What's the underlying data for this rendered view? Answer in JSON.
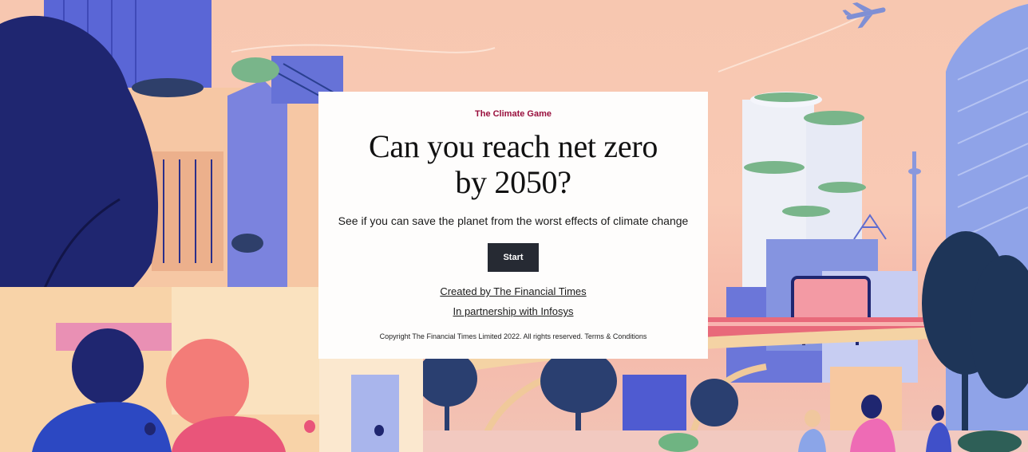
{
  "card": {
    "eyebrow": "The Climate Game",
    "headline_line1": "Can you reach net zero",
    "headline_line2": "by 2050?",
    "subtitle": "See if you can save the planet from the worst effects of climate change",
    "start_label": "Start",
    "created_by": "Created by The Financial Times",
    "partnership": "In partnership with Infosys",
    "copyright": "Copyright The Financial Times Limited 2022. All rights reserved.",
    "terms_link": "Terms & Conditions"
  },
  "colors": {
    "eyebrow": "#990f3d",
    "button_bg": "#262a33",
    "card_bg": "#fefdfc",
    "sky": "#f7c7b0",
    "navy": "#1f2670",
    "periwinkle": "#6b76d9",
    "peach": "#f7c8a0"
  },
  "illustration": {
    "description_icons": [
      "airplane-icon",
      "skyline-illustration",
      "tree-icon",
      "monorail-track"
    ]
  }
}
